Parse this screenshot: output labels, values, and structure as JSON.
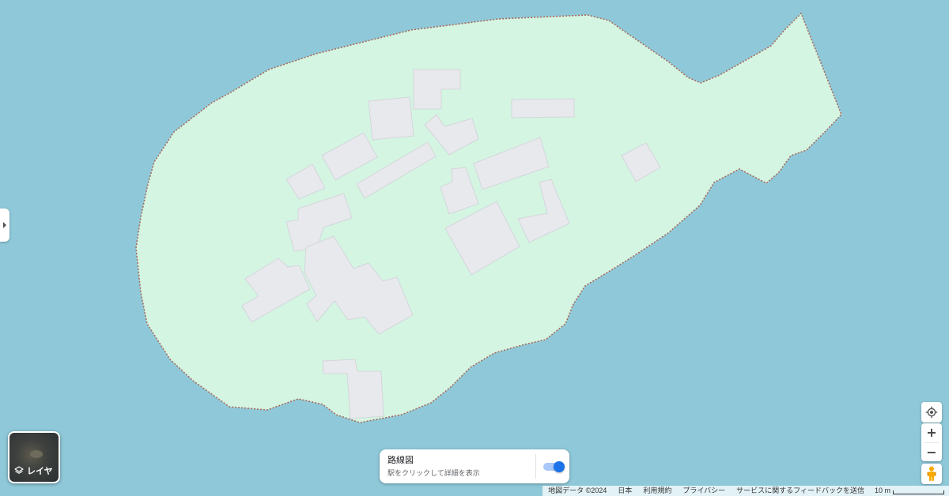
{
  "map": {
    "water_color": "#8fc9d9",
    "land_color": "#d4f5e2",
    "border_color": "#a86b5c",
    "building_fill": "#e8e9ec",
    "building_stroke": "#d3d6dc"
  },
  "side_panel": {
    "icon": "chevron-right-icon"
  },
  "layers": {
    "label": "レイヤ",
    "icon": "layers-icon"
  },
  "transit": {
    "title": "路線図",
    "subtitle": "駅をクリックして詳細を表示",
    "toggle_on": true,
    "accent_color": "#1a73e8"
  },
  "controls": {
    "locate_icon": "my-location-icon",
    "zoom_in": "+",
    "zoom_out": "−",
    "pegman_icon": "pegman-icon"
  },
  "footer": {
    "map_data": "地図データ ©2024",
    "country": "日本",
    "terms": "利用規約",
    "privacy": "プライバシー",
    "feedback": "サービスに関するフィードバックを送信",
    "scale": "10 m"
  }
}
